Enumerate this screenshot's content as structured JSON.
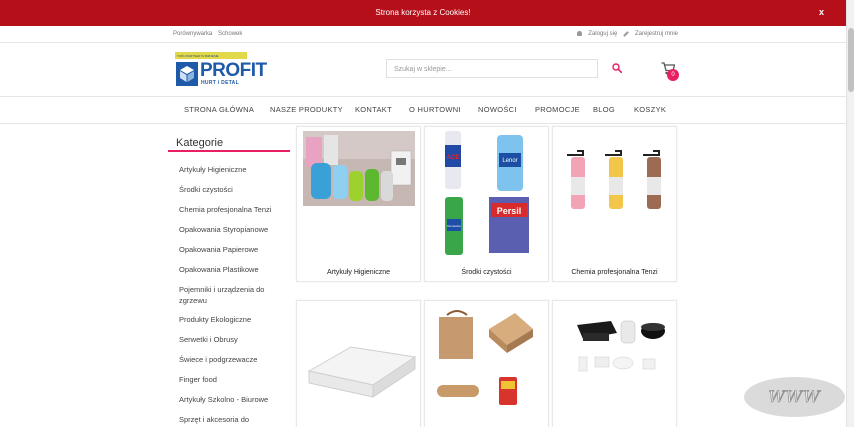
{
  "cookie": {
    "text": "Strona korzysta z Cookies!",
    "close": "x"
  },
  "top_links": {
    "compare": "Porównywarka",
    "wishlist": "Schowek",
    "login": "Zaloguj się",
    "register": "Zarejestruj mnie"
  },
  "logo": {
    "banner": "TWÓJ PARTNER W BIZNESIE",
    "name": "PROFIT",
    "tagline": "HURT i DETAL"
  },
  "search": {
    "placeholder": "Szukaj w sklepie..."
  },
  "cart": {
    "count": "0"
  },
  "nav": [
    "STRONA GŁÓWNA",
    "NASZE PRODUKTY",
    "KONTAKT",
    "O HURTOWNI",
    "NOWOŚCI",
    "PROMOCJE",
    "BLOG",
    "KOSZYK"
  ],
  "categories": {
    "title": "Kategorie",
    "items": [
      "Artykuły Higieniczne",
      "Środki czystości",
      "Chemia profesjonalna Tenzi",
      "Opakowania Styropianowe",
      "Opakowania Papierowe",
      "Opakowania Plastikowe",
      "Pojemniki i urządzenia do zgrzewu",
      "Produkty Ekologiczne",
      "Serwetki i Obrusy",
      "Świece i podgrzewacze",
      "Finger food",
      "Artykuły Szkolno - Biurowe",
      "Sprzęt i akcesoria do"
    ]
  },
  "products": [
    "Artykuły Higieniczne",
    "Środki czystości",
    "Chemia profesjonalna Tenzi"
  ],
  "product_brands": {
    "ace": "ACE",
    "lenor": "Lenor",
    "domestos": "Domestos",
    "persil": "Persil"
  },
  "watermark": "WWW",
  "colors": {
    "cookie_bar": "#b50f1a",
    "accent": "#e91e63",
    "brand_blue": "#1e5aa8",
    "brand_yellow": "#e2d94a"
  }
}
